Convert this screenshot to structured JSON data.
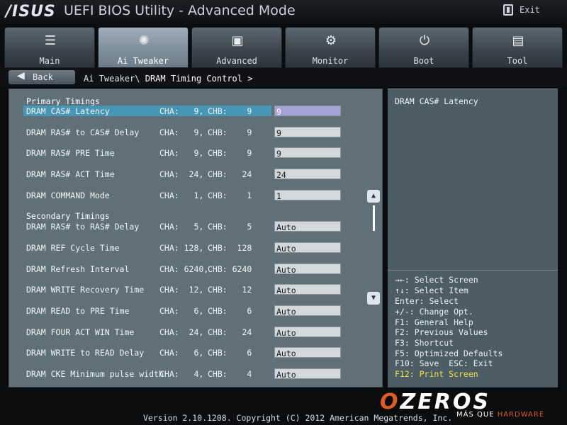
{
  "header": {
    "logo": "/ISUS",
    "title": "UEFI BIOS Utility - Advanced Mode",
    "exit_label": "Exit"
  },
  "tabs": [
    {
      "label": "Main",
      "icon": "list-icon",
      "glyph": "☰"
    },
    {
      "label": "Ai Tweaker",
      "icon": "tweaker-icon",
      "glyph": "✺"
    },
    {
      "label": "Advanced",
      "icon": "advanced-icon",
      "glyph": "▣"
    },
    {
      "label": "Monitor",
      "icon": "thermometer-icon",
      "glyph": "⚙"
    },
    {
      "label": "Boot",
      "icon": "power-icon",
      "glyph": "⏻"
    },
    {
      "label": "Tool",
      "icon": "toolbox-icon",
      "glyph": "▤"
    }
  ],
  "active_tab": "Ai Tweaker",
  "nav": {
    "back_label": "Back",
    "breadcrumb_parent": "Ai Tweaker\\",
    "breadcrumb_current": "DRAM Timing Control >"
  },
  "sections": {
    "primary": "Primary Timings",
    "secondary": "Secondary Timings"
  },
  "rows": [
    {
      "name": "DRAM CAS# Latency",
      "cha": "CHA:   9,",
      "chb": "CHB:    9",
      "value": "9"
    },
    {
      "name": "DRAM RAS# to CAS# Delay",
      "cha": "CHA:   9,",
      "chb": "CHB:    9",
      "value": "9"
    },
    {
      "name": "DRAM RAS# PRE Time",
      "cha": "CHA:   9,",
      "chb": "CHB:    9",
      "value": "9"
    },
    {
      "name": "DRAM RAS# ACT Time",
      "cha": "CHA:  24,",
      "chb": "CHB:   24",
      "value": "24"
    },
    {
      "name": "DRAM COMMAND Mode",
      "cha": "CHA:   1,",
      "chb": "CHB:    1",
      "value": "1"
    },
    {
      "name": "DRAM RAS# to RAS# Delay",
      "cha": "CHA:   5,",
      "chb": "CHB:    5",
      "value": "Auto"
    },
    {
      "name": "DRAM REF Cycle Time",
      "cha": "CHA: 128,",
      "chb": "CHB:  128",
      "value": "Auto"
    },
    {
      "name": "DRAM Refresh Interval",
      "cha": "CHA: 6240,",
      "chb": "CHB: 6240",
      "value": "Auto"
    },
    {
      "name": "DRAM WRITE Recovery Time",
      "cha": "CHA:  12,",
      "chb": "CHB:   12",
      "value": "Auto"
    },
    {
      "name": "DRAM READ to PRE Time",
      "cha": "CHA:   6,",
      "chb": "CHB:    6",
      "value": "Auto"
    },
    {
      "name": "DRAM FOUR ACT WIN Time",
      "cha": "CHA:  24,",
      "chb": "CHB:   24",
      "value": "Auto"
    },
    {
      "name": "DRAM WRITE to READ Delay",
      "cha": "CHA:   6,",
      "chb": "CHB:    6",
      "value": "Auto"
    },
    {
      "name": "DRAM CKE Minimum pulse width",
      "cha": "CHA:   4,",
      "chb": "CHB:    4",
      "value": "Auto"
    }
  ],
  "help": {
    "text": "DRAM CAS# Latency"
  },
  "keys": [
    "→←: Select Screen",
    "↑↓: Select Item",
    "Enter: Select",
    "+/-: Change Opt.",
    "F1: General Help",
    "F2: Previous Values",
    "F3: Shortcut",
    "F5: Optimized Defaults",
    "F10: Save  ESC: Exit",
    "F12: Print Screen"
  ],
  "footer": {
    "version": "Version 2.10.1208. Copyright (C) 2012 American Megatrends, Inc."
  },
  "watermark": {
    "brand_o": "O",
    "brand_rest": "ZEROS",
    "tagline_a": "MÁS QUE ",
    "tagline_b": "HARDWARE"
  },
  "colors": {
    "selected_row": "#4896b6",
    "selected_value": "#a7a2d6",
    "highlight_key": "#f4e23a",
    "panel": "#5f7079"
  }
}
